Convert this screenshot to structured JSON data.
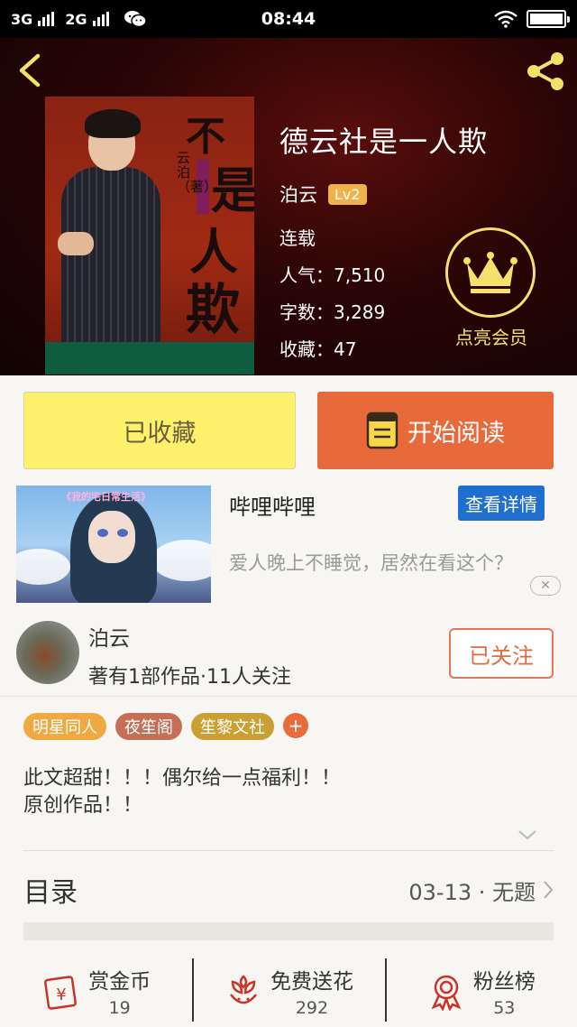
{
  "status_bar": {
    "network1": "3G",
    "network2": "2G",
    "time": "08:44"
  },
  "book": {
    "title": "德云社是一人欺",
    "author": "泊云",
    "level": "Lv2",
    "status": "连载",
    "popularity": "人气：7,510",
    "word_count": "字数：3,289",
    "favorites": "收藏：47",
    "cover_text": {
      "c1": "不",
      "c2": "是",
      "c3": "人",
      "c4": "欺",
      "vertical": "云泊（著）",
      "stamp": "德云社"
    }
  },
  "vip": {
    "label": "点亮会员"
  },
  "actions": {
    "collected": "已收藏",
    "read": "开始阅读"
  },
  "ad": {
    "image_caption": "《我的宅日常生活》",
    "title": "哔哩哔哩",
    "detail": "查看详情",
    "description": "爱人晚上不睡觉，居然在看这个？",
    "close": "✕"
  },
  "author_card": {
    "name": "泊云",
    "meta": "著有1部作品·11人关注",
    "follow": "已关注"
  },
  "tags": [
    {
      "label": "明星同人",
      "color": "#f0a840"
    },
    {
      "label": "夜笙阁",
      "color": "#c47058"
    },
    {
      "label": "笙黎文社",
      "color": "#c9a034"
    }
  ],
  "tag_add": "+",
  "description": {
    "line1": "此文超甜！！！偶尔给一点福利！！",
    "line2": "原创作品！！"
  },
  "toc": {
    "label": "目录",
    "latest": "03-13 · 无题"
  },
  "bottom_bar": [
    {
      "label": "赏金币",
      "value": "19",
      "icon": "reward-coin-icon"
    },
    {
      "label": "免费送花",
      "value": "292",
      "icon": "flower-icon"
    },
    {
      "label": "粉丝榜",
      "value": "53",
      "icon": "medal-icon"
    }
  ],
  "colors": {
    "accent_orange": "#e86a3a",
    "collected_yellow": "#fdf06c",
    "vip_gold": "#f5e06a",
    "ad_blue": "#1e6fd0",
    "icon_red": "#c8342a"
  }
}
